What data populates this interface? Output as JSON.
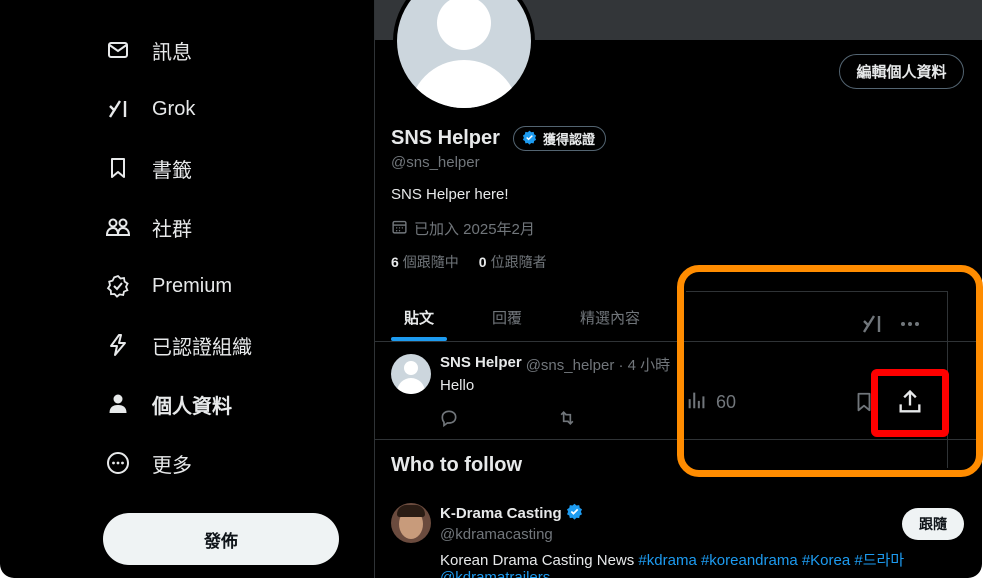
{
  "sidebar": {
    "items": [
      {
        "label": "訊息",
        "icon": "envelope-icon"
      },
      {
        "label": "Grok",
        "icon": "grok-icon"
      },
      {
        "label": "書籤",
        "icon": "bookmark-icon"
      },
      {
        "label": "社群",
        "icon": "communities-icon"
      },
      {
        "label": "Premium",
        "icon": "premium-icon"
      },
      {
        "label": "已認證組織",
        "icon": "lightning-icon"
      },
      {
        "label": "個人資料",
        "icon": "person-icon"
      },
      {
        "label": "更多",
        "icon": "more-circle-icon"
      }
    ],
    "post_label": "發佈"
  },
  "profile": {
    "edit_label": "編輯個人資料",
    "name": "SNS Helper",
    "verify_label": "獲得認證",
    "handle": "@sns_helper",
    "bio": "SNS Helper here!",
    "joined": "已加入 2025年2月",
    "following_count": "6",
    "following_label": "個跟隨中",
    "followers_count": "0",
    "followers_label": "位跟隨者"
  },
  "tabs": [
    {
      "label": "貼文",
      "active": true
    },
    {
      "label": "回覆",
      "active": false
    },
    {
      "label": "精選內容",
      "active": false
    }
  ],
  "tweet": {
    "name": "SNS Helper",
    "meta": "@sns_helper · 4 小時",
    "text": "Hello"
  },
  "who_to_follow": {
    "title": "Who to follow",
    "item": {
      "name": "K-Drama Casting",
      "handle": "@kdramacasting",
      "bio_text": "Korean Drama Casting News ",
      "bio_tags": "#kdrama #koreandrama #Korea #드라마",
      "bio_line2": "@kdramatrailers",
      "follow_label": "跟隨"
    }
  },
  "panel": {
    "views": "60"
  },
  "colors": {
    "accent": "#1d9bf0",
    "highlight_orange": "#ff8c00",
    "highlight_red": "#ff0000"
  }
}
